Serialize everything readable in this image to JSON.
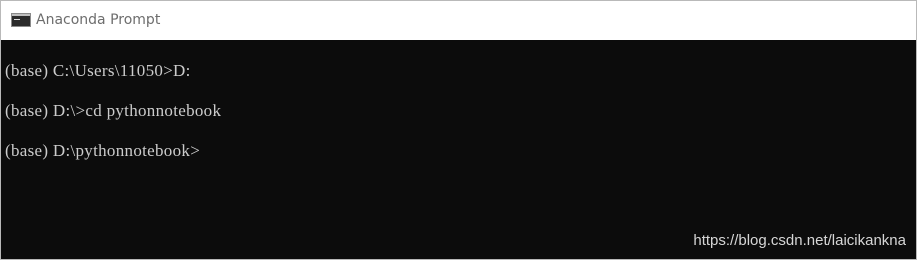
{
  "window": {
    "title": "Anaconda Prompt",
    "icon": "console-app-icon"
  },
  "console": {
    "lines": [
      "(base) C:\\Users\\11050>D:",
      "(base) D:\\>cd pythonnotebook",
      "(base) D:\\pythonnotebook>"
    ]
  },
  "watermark": {
    "text": "https://blog.csdn.net/laicikankna"
  },
  "colors": {
    "console_background": "#0c0c0c",
    "console_text": "#cccccc",
    "titlebar_background": "#ffffff",
    "title_text": "#6d6d6d"
  }
}
